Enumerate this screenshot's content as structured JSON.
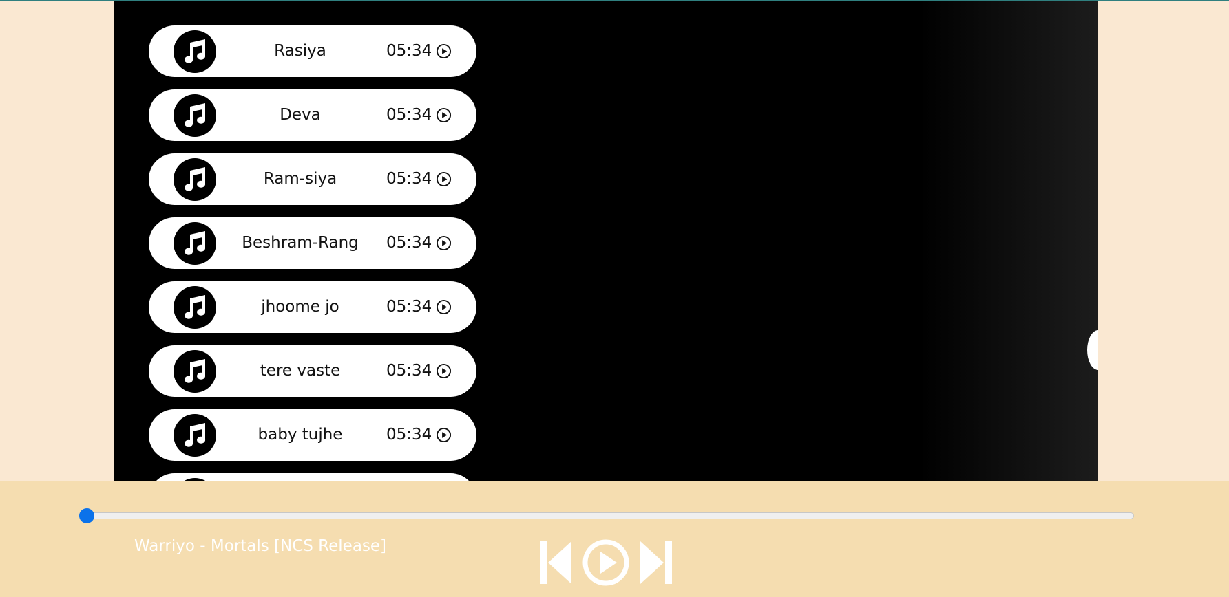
{
  "colors": {
    "page_background": "#fae8d2",
    "stage_background": "#000000",
    "player_bar": "#f5ddb0",
    "seek_thumb": "#0b72ea",
    "top_line": "#2f7f7f"
  },
  "playlist": {
    "items": [
      {
        "icon": "music-note-icon",
        "title": "Rasiya",
        "duration": "05:34",
        "action_icon": "play-circle-icon"
      },
      {
        "icon": "music-note-icon",
        "title": "Deva",
        "duration": "05:34",
        "action_icon": "play-circle-icon"
      },
      {
        "icon": "music-note-icon",
        "title": "Ram-siya",
        "duration": "05:34",
        "action_icon": "play-circle-icon"
      },
      {
        "icon": "music-note-icon",
        "title": "Beshram-Rang",
        "duration": "05:34",
        "action_icon": "play-circle-icon"
      },
      {
        "icon": "music-note-icon",
        "title": "jhoome jo",
        "duration": "05:34",
        "action_icon": "play-circle-icon"
      },
      {
        "icon": "music-note-icon",
        "title": "tere vaste",
        "duration": "05:34",
        "action_icon": "play-circle-icon"
      },
      {
        "icon": "music-note-icon",
        "title": "baby tujhe",
        "duration": "05:34",
        "action_icon": "play-circle-icon"
      }
    ]
  },
  "player": {
    "now_playing": "Warriyo - Mortals [NCS Release]",
    "progress_percent": 0,
    "controls": [
      {
        "name": "previous",
        "icon": "skip-previous-icon"
      },
      {
        "name": "play",
        "icon": "play-circle-icon"
      },
      {
        "name": "next",
        "icon": "skip-next-icon"
      }
    ]
  }
}
